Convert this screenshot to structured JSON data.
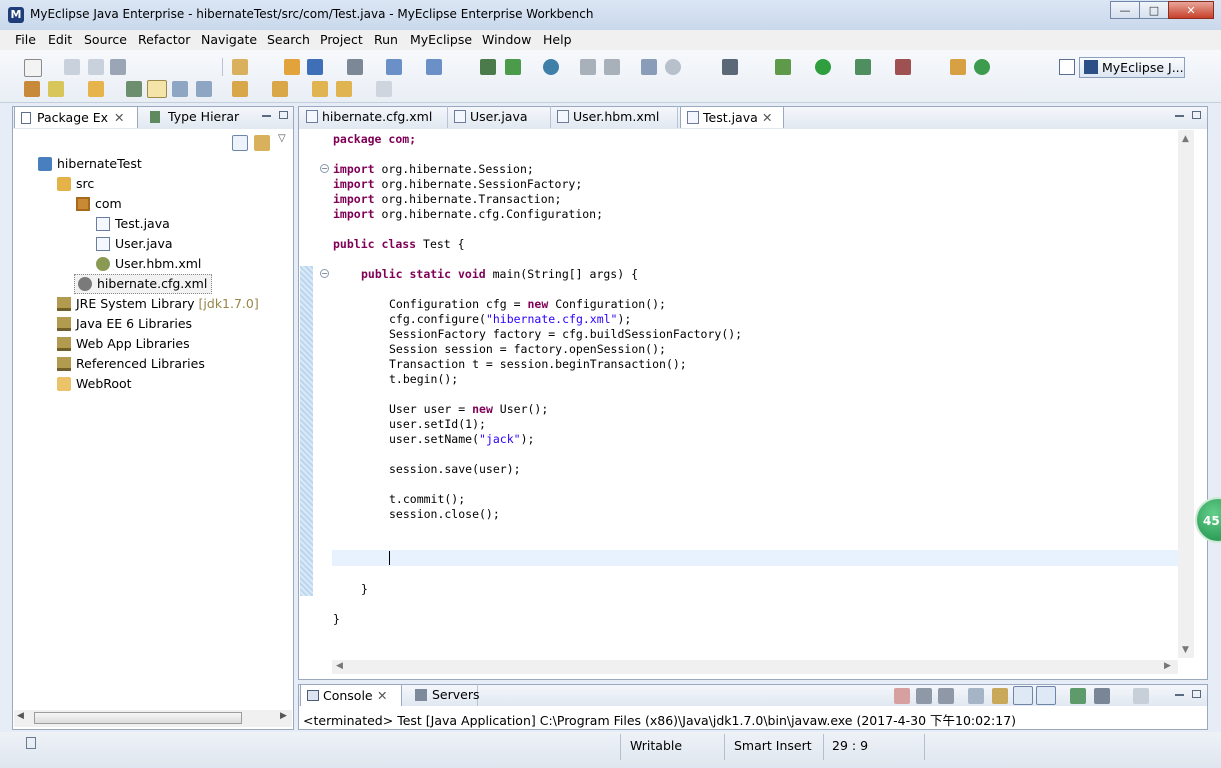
{
  "window": {
    "title": "MyEclipse Java Enterprise - hibernateTest/src/com/Test.java - MyEclipse Enterprise Workbench",
    "minimize": "—",
    "maximize": "□",
    "close": "✕"
  },
  "menu": [
    "File",
    "Edit",
    "Source",
    "Refactor",
    "Navigate",
    "Search",
    "Project",
    "Run",
    "MyEclipse",
    "Window",
    "Help"
  ],
  "perspective": {
    "label": "MyEclipse J..."
  },
  "left_view": {
    "tabs": [
      "Package Ex",
      "Type Hierar"
    ],
    "tree": [
      {
        "label": "hibernateTest",
        "icon": "project-icon"
      },
      {
        "label": "src",
        "icon": "source-folder-icon"
      },
      {
        "label": "com",
        "icon": "package-icon"
      },
      {
        "label": "Test.java",
        "icon": "java-file-icon"
      },
      {
        "label": "User.java",
        "icon": "java-file-icon"
      },
      {
        "label": "User.hbm.xml",
        "icon": "hbm-file-icon"
      },
      {
        "label": "hibernate.cfg.xml",
        "icon": "xml-file-icon"
      },
      {
        "label": "JRE System Library",
        "decoration": "[jdk1.7.0]",
        "icon": "library-icon"
      },
      {
        "label": "Java EE 6 Libraries",
        "icon": "library-icon"
      },
      {
        "label": "Web App Libraries",
        "icon": "library-icon"
      },
      {
        "label": "Referenced Libraries",
        "icon": "library-icon"
      },
      {
        "label": "WebRoot",
        "icon": "folder-icon"
      }
    ]
  },
  "editor": {
    "tabs": [
      "hibernate.cfg.xml",
      "User.java",
      "User.hbm.xml",
      "Test.java"
    ],
    "code": {
      "l1": "package com;",
      "l3": "import org.hibernate.Session;",
      "l4": "import org.hibernate.SessionFactory;",
      "l5": "import org.hibernate.Transaction;",
      "l6": "import org.hibernate.cfg.Configuration;",
      "l8": "public class Test {",
      "l10": "public static void main(String[] args) {",
      "l12": "Configuration cfg = new Configuration();",
      "l13a": "cfg.configure(",
      "l13s": "\"hibernate.cfg.xml\"",
      "l13b": ");",
      "l14": "SessionFactory factory = cfg.buildSessionFactory();",
      "l15": "Session session = factory.openSession();",
      "l16": "Transaction t = session.beginTransaction();",
      "l17": "t.begin();",
      "l19": "User user = new User();",
      "l20": "user.setId(1);",
      "l21a": "user.setName(",
      "l21s": "\"jack\"",
      "l21b": ");",
      "l23": "session.save(user);",
      "l25": "t.commit();",
      "l26": "session.close();",
      "l30": "}",
      "l32": "}"
    }
  },
  "console": {
    "tabs": [
      "Console",
      "Servers"
    ],
    "text": "<terminated> Test [Java Application] C:\\Program Files (x86)\\Java\\jdk1.7.0\\bin\\javaw.exe (2017-4-30 下午10:02:17)"
  },
  "status": {
    "mode": "Writable",
    "insert": "Smart Insert",
    "position": "29 : 9"
  },
  "badge": {
    "text": "45"
  },
  "colors": {
    "keyword": "#7f0055",
    "string": "#2a00ff",
    "background": "#e6edf6"
  }
}
